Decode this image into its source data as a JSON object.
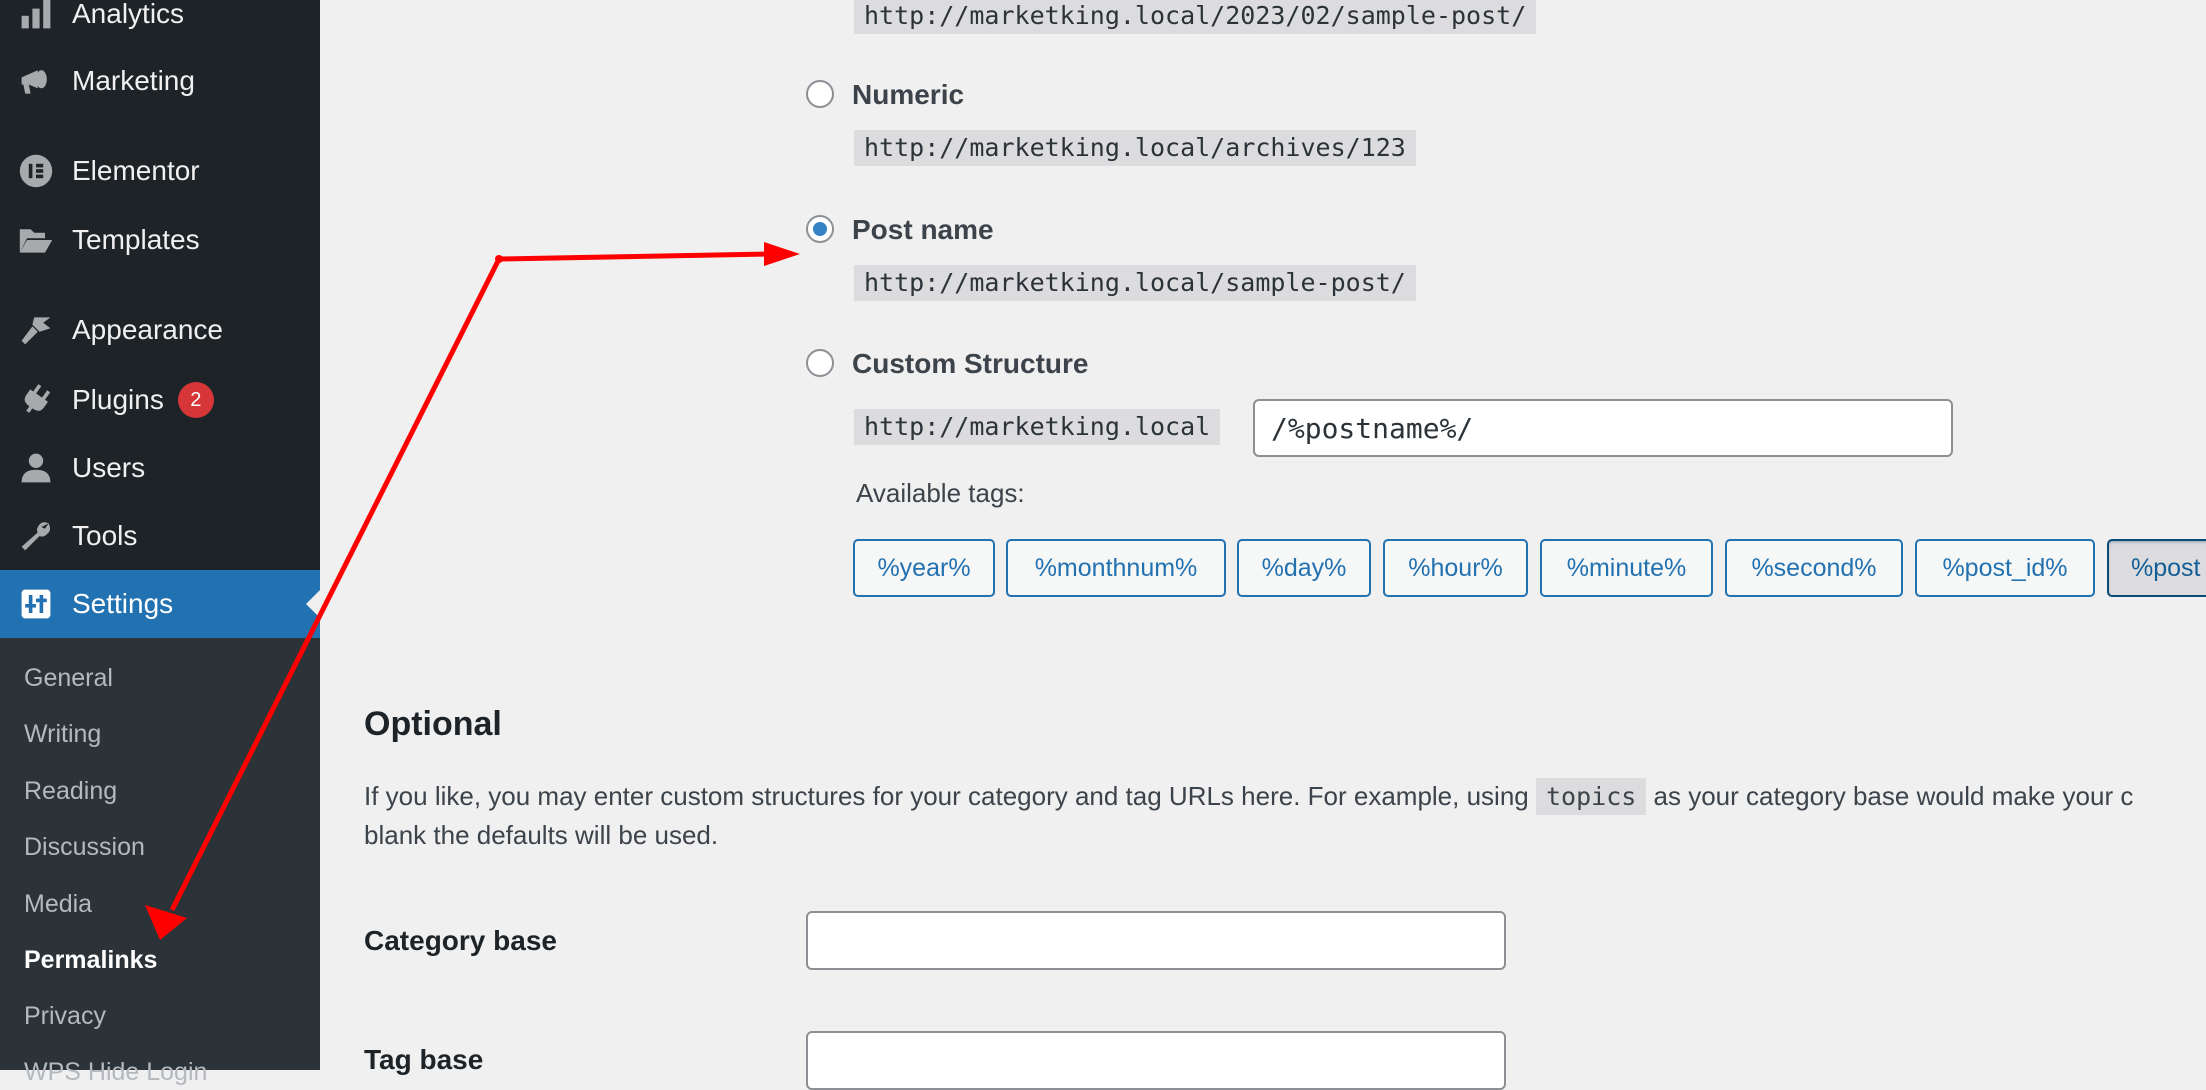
{
  "sidebar": {
    "items": [
      {
        "label": "Analytics",
        "icon": "bar-chart-icon"
      },
      {
        "label": "Marketing",
        "icon": "megaphone-icon"
      },
      {
        "label": "Elementor",
        "icon": "elementor-icon"
      },
      {
        "label": "Templates",
        "icon": "folder-open-icon"
      },
      {
        "label": "Appearance",
        "icon": "paintbrush-icon"
      },
      {
        "label": "Plugins",
        "icon": "plug-icon",
        "badge": "2"
      },
      {
        "label": "Users",
        "icon": "user-icon"
      },
      {
        "label": "Tools",
        "icon": "wrench-icon"
      },
      {
        "label": "Settings",
        "icon": "settings-sliders-icon",
        "active": true
      }
    ],
    "submenu": [
      {
        "label": "General"
      },
      {
        "label": "Writing"
      },
      {
        "label": "Reading"
      },
      {
        "label": "Discussion"
      },
      {
        "label": "Media"
      },
      {
        "label": "Permalinks",
        "current": true
      },
      {
        "label": "Privacy"
      },
      {
        "label": "WPS Hide Login"
      }
    ]
  },
  "permalinks": {
    "month_and_name_example": "http://marketking.local/2023/02/sample-post/",
    "options": [
      {
        "label": "Numeric",
        "example": "http://marketking.local/archives/123",
        "checked": false
      },
      {
        "label": "Post name",
        "example": "http://marketking.local/sample-post/",
        "checked": true
      },
      {
        "label": "Custom Structure",
        "checked": false
      }
    ],
    "custom": {
      "prefix": "http://marketking.local",
      "value": "/%postname%/"
    },
    "available_tags_label": "Available tags:",
    "tags": [
      "%year%",
      "%monthnum%",
      "%day%",
      "%hour%",
      "%minute%",
      "%second%",
      "%post_id%",
      "%post"
    ]
  },
  "optional": {
    "heading": "Optional",
    "description_before": "If you like, you may enter custom structures for your category and tag URLs here. For example, using",
    "description_code": "topics",
    "description_after": "as your category base would make your c",
    "description_line2": "blank the defaults will be used.",
    "category_base_label": "Category base",
    "category_base_value": "",
    "tag_base_label": "Tag base",
    "tag_base_value": ""
  },
  "colors": {
    "accent": "#2271b1",
    "sidebar_bg": "#1d2327",
    "submenu_bg": "#2c3338",
    "badge": "#d63638",
    "annotation_arrow": "#ff0000"
  }
}
